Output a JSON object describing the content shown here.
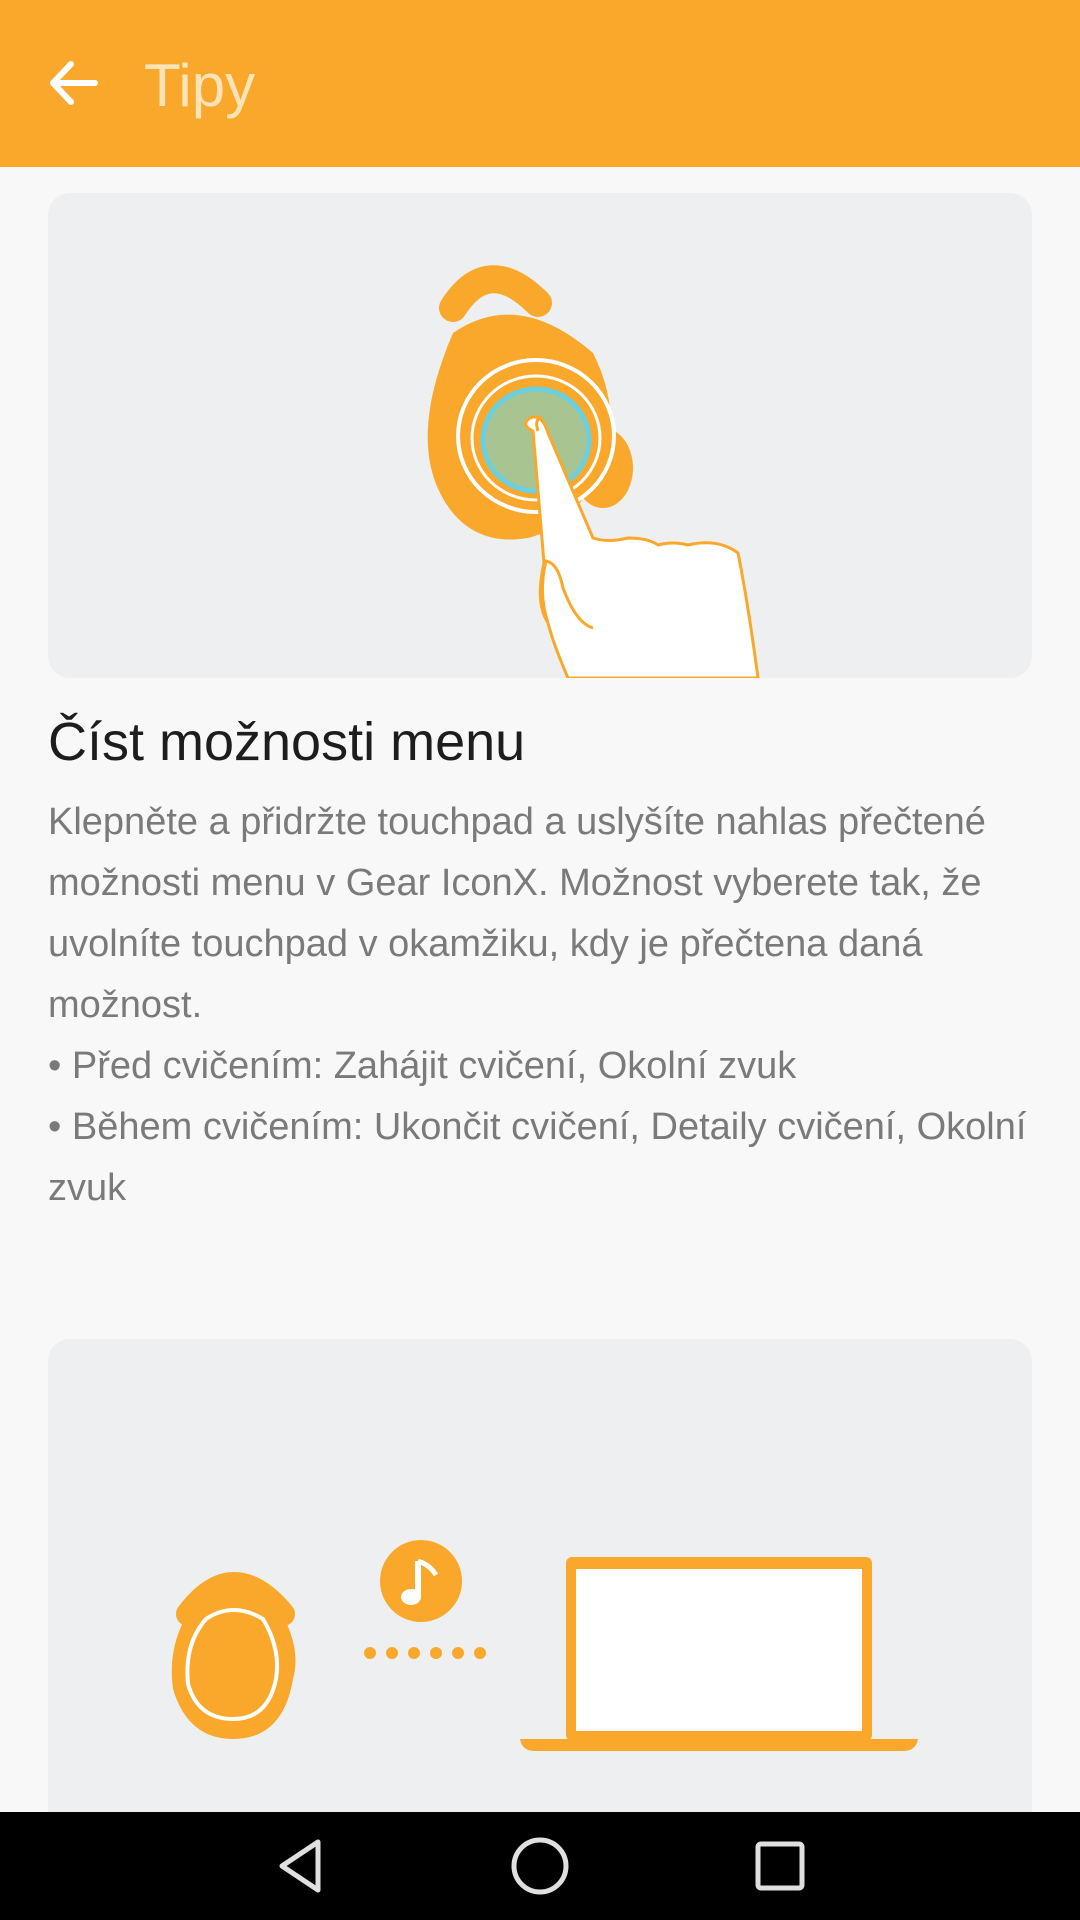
{
  "app_bar": {
    "title": "Tipy",
    "back_icon": "arrow-back-icon"
  },
  "tip": {
    "title": "Číst možnosti menu",
    "description": "Klepněte a přidržte touchpad a uslyšíte nahlas přečtené možnosti menu v Gear IconX. Možnost vyberete tak, že uvolníte touchpad v okamžiku, kdy je přečtena daná možnost.",
    "bullets": [
      "• Před cvičením: Zahájit cvičení, Okolní zvuk",
      "• Během cvičením: Ukončit cvičení, Detaily cvičení, Okolní zvuk"
    ]
  },
  "illustrations": {
    "first": "earbud-touch-illustration",
    "second": "earbud-laptop-music-illustration"
  },
  "nav_bar": {
    "back": "nav-back-icon",
    "home": "nav-home-icon",
    "recents": "nav-recents-icon"
  },
  "colors": {
    "accent": "#f9a82b",
    "title_text": "#fde3b7",
    "card_bg": "#eeeff1",
    "body_text": "#7a7a7a"
  }
}
